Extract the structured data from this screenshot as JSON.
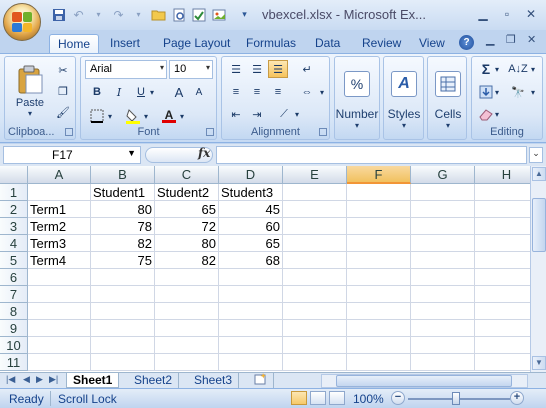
{
  "window": {
    "title": "vbexcel.xlsx - Microsoft Ex..."
  },
  "ribbon_tabs": [
    "Home",
    "Insert",
    "Page Layout",
    "Formulas",
    "Data",
    "Review",
    "View"
  ],
  "active_tab": "Home",
  "clipboard": {
    "paste_label": "Paste",
    "group_label": "Clipboa..."
  },
  "font": {
    "name": "Arial",
    "size": "10",
    "group_label": "Font",
    "bold": "B",
    "italic": "I",
    "underline": "U",
    "grow": "A",
    "shrink": "A"
  },
  "alignment": {
    "group_label": "Alignment"
  },
  "number": {
    "label": "Number",
    "symbol": "%"
  },
  "styles": {
    "label": "Styles"
  },
  "cells": {
    "label": "Cells"
  },
  "editing": {
    "group_label": "Editing",
    "sigma": "Σ"
  },
  "formula_bar": {
    "name_box": "F17",
    "fx": "fx",
    "value": ""
  },
  "columns": [
    "A",
    "B",
    "C",
    "D",
    "E",
    "F",
    "G",
    "H"
  ],
  "selected_column": "F",
  "rows": [
    "1",
    "2",
    "3",
    "4",
    "5",
    "6",
    "7",
    "8",
    "9",
    "10",
    "11"
  ],
  "cells_data": {
    "row1": [
      "",
      "Student1",
      "Student2",
      "Student3",
      "",
      "",
      "",
      ""
    ],
    "row2": [
      "Term1",
      "80",
      "65",
      "45",
      "",
      "",
      "",
      ""
    ],
    "row3": [
      "Term2",
      "78",
      "72",
      "60",
      "",
      "",
      "",
      ""
    ],
    "row4": [
      "Term3",
      "82",
      "80",
      "65",
      "",
      "",
      "",
      ""
    ],
    "row5": [
      "Term4",
      "75",
      "82",
      "68",
      "",
      "",
      "",
      ""
    ]
  },
  "sheet_tabs": [
    "Sheet1",
    "Sheet2",
    "Sheet3"
  ],
  "active_sheet": "Sheet1",
  "status": {
    "ready": "Ready",
    "scroll_lock": "Scroll Lock",
    "zoom": "100%"
  },
  "colors": {
    "accent": "#15428b",
    "ribbon_bg": "#bfd4ef",
    "selected_header": "#f1c15f"
  }
}
